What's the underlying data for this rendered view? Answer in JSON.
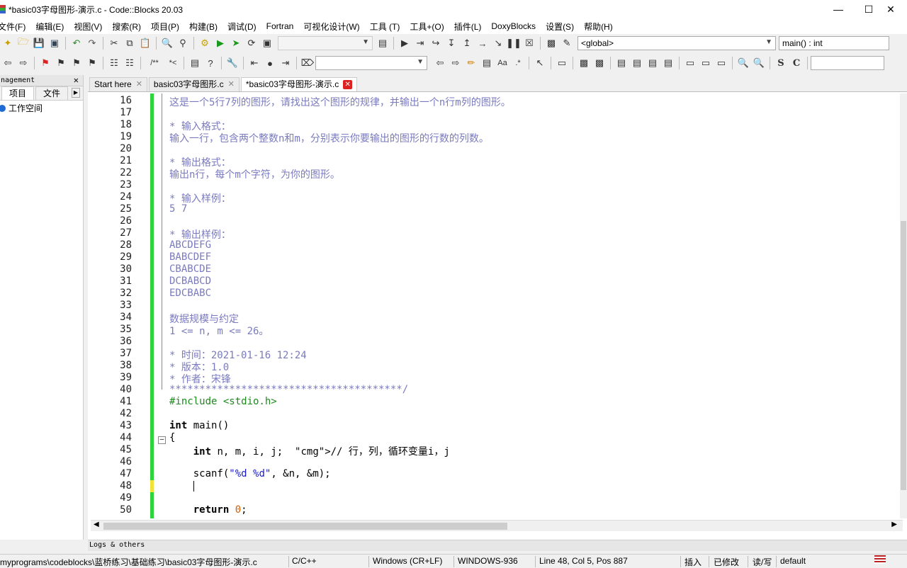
{
  "window": {
    "title": "*basic03字母图形-演示.c - Code::Blocks 20.03"
  },
  "menu": [
    "文件(F)",
    "编辑(E)",
    "视图(V)",
    "搜索(R)",
    "项目(P)",
    "构建(B)",
    "调试(D)",
    "Fortran",
    "可视化设计(W)",
    "工具 (T)",
    "工具+(O)",
    "插件(L)",
    "DoxyBlocks",
    "设置(S)",
    "帮助(H)"
  ],
  "toolbar": {
    "scope_combo": "<global>",
    "function_combo": "main() : int",
    "build_target": "",
    "search_combo": ""
  },
  "left_panel": {
    "header": "nagement",
    "tabs": [
      "项目",
      "文件"
    ],
    "tree_root": "工作空间"
  },
  "tabs": [
    {
      "label": "Start here"
    },
    {
      "label": "basic03字母图形.c"
    },
    {
      "label": "*basic03字母图形-演示.c"
    }
  ],
  "code_lines": [
    {
      "n": "16",
      "t": "这是一个5行7列的图形，请找出这个图形的规律，并输出一个n行m列的图形。",
      "c": "cm"
    },
    {
      "n": "17",
      "t": "",
      "c": "cm"
    },
    {
      "n": "18",
      "t": "* 输入格式：",
      "c": "cm"
    },
    {
      "n": "19",
      "t": "输入一行，包含两个整数n和m，分别表示你要输出的图形的行数的列数。",
      "c": "cm"
    },
    {
      "n": "20",
      "t": "",
      "c": "cm"
    },
    {
      "n": "21",
      "t": "* 输出格式：",
      "c": "cm"
    },
    {
      "n": "22",
      "t": "输出n行，每个m个字符，为你的图形。",
      "c": "cm"
    },
    {
      "n": "23",
      "t": "",
      "c": "cm"
    },
    {
      "n": "24",
      "t": "* 输入样例：",
      "c": "cm"
    },
    {
      "n": "25",
      "t": "5 7",
      "c": "cm"
    },
    {
      "n": "26",
      "t": "",
      "c": "cm"
    },
    {
      "n": "27",
      "t": "* 输出样例：",
      "c": "cm"
    },
    {
      "n": "28",
      "t": "ABCDEFG",
      "c": "cm"
    },
    {
      "n": "29",
      "t": "BABCDEF",
      "c": "cm"
    },
    {
      "n": "30",
      "t": "CBABCDE",
      "c": "cm"
    },
    {
      "n": "31",
      "t": "DCBABCD",
      "c": "cm"
    },
    {
      "n": "32",
      "t": "EDCBABC",
      "c": "cm"
    },
    {
      "n": "33",
      "t": "",
      "c": "cm"
    },
    {
      "n": "34",
      "t": "数据规模与约定",
      "c": "cm"
    },
    {
      "n": "35",
      "t": "1 <= n, m <= 26。",
      "c": "cm"
    },
    {
      "n": "36",
      "t": "",
      "c": "cm"
    },
    {
      "n": "37",
      "t": "* 时间：2021-01-16 12:24",
      "c": "cm"
    },
    {
      "n": "38",
      "t": "* 版本：1.0",
      "c": "cm"
    },
    {
      "n": "39",
      "t": "* 作者：宋锋",
      "c": "cm"
    },
    {
      "n": "40",
      "t": "***************************************/",
      "c": "cm"
    },
    {
      "n": "41",
      "t": "#include <stdio.h>",
      "c": "pp"
    },
    {
      "n": "42",
      "t": "",
      "c": "pl"
    },
    {
      "n": "43",
      "t": "int main()",
      "c": "pl"
    },
    {
      "n": "44",
      "t": "{",
      "c": "pl"
    },
    {
      "n": "45",
      "t": "    int n, m, i, j;  // 行，列，循环变量i，j",
      "c": "pl"
    },
    {
      "n": "46",
      "t": "",
      "c": "pl"
    },
    {
      "n": "47",
      "t": "    scanf(\"%d %d\", &n, &m);",
      "c": "pl"
    },
    {
      "n": "48",
      "t": "    ",
      "c": "pl"
    },
    {
      "n": "49",
      "t": "",
      "c": "pl"
    },
    {
      "n": "50",
      "t": "    return 0;",
      "c": "pl"
    }
  ],
  "logs_panel": "Logs & others",
  "status": {
    "path": "myprograms\\codeblocks\\蓝桥练习\\基础练习\\basic03字母图形-演示.c",
    "language": "C/C++",
    "eol": "Windows (CR+LF)",
    "encoding": "WINDOWS-936",
    "position": "Line 48, Col 5, Pos 887",
    "insert": "插入",
    "modified": "已修改",
    "rw": "读/写",
    "profile": "default"
  }
}
